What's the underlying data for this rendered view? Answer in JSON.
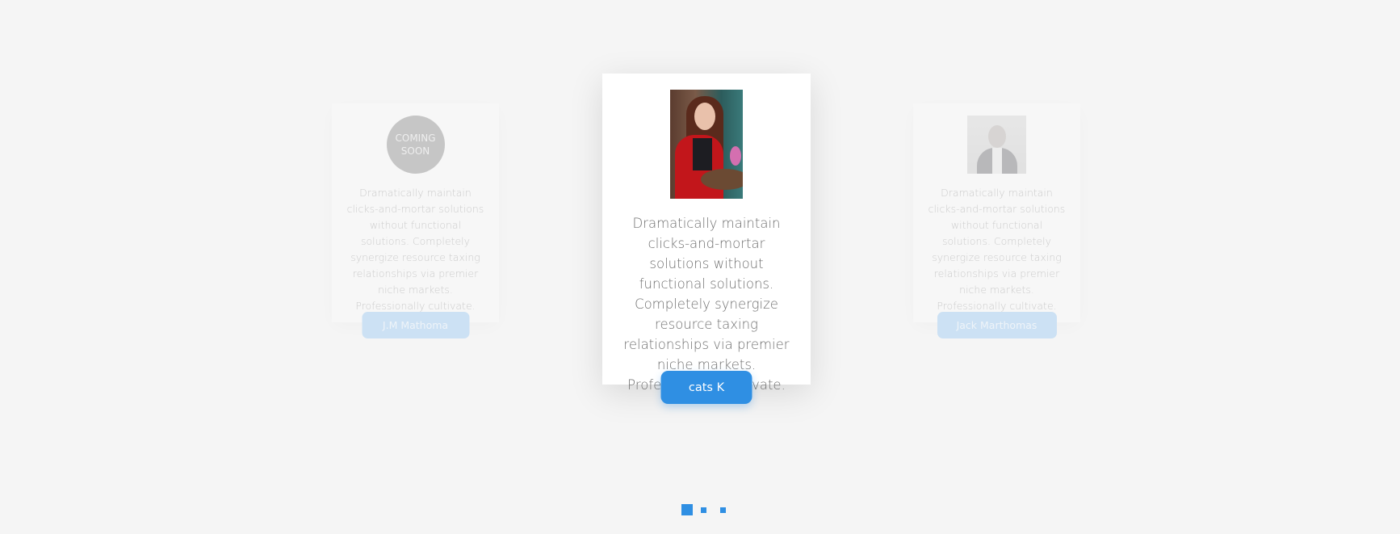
{
  "slides": [
    {
      "avatar_text": "COMING\nSOON",
      "description": "Dramatically maintain clicks-and-mortar solutions without functional solutions. Completely synergize resource taxing relationships via premier niche markets. Professionally cultivate.",
      "name": "J.M Mathoma"
    },
    {
      "description": "Dramatically maintain clicks-and-mortar solutions without functional solutions. Completely synergize resource taxing relationships via premier niche markets. Professionally cultivate.",
      "name": "cats K"
    },
    {
      "description": "Dramatically maintain clicks-and-mortar solutions without functional solutions. Completely synergize resource taxing relationships via premier niche markets. Professionally cultivate.",
      "name": "Jack Marthomas"
    }
  ],
  "pagination": {
    "count": 3,
    "active_index": 0
  },
  "colors": {
    "accent": "#2f8fe3",
    "background": "#f5f5f5",
    "card": "#ffffff",
    "text": "#6f6f6f"
  },
  "icons": [
    "pagination-dot-icon"
  ]
}
